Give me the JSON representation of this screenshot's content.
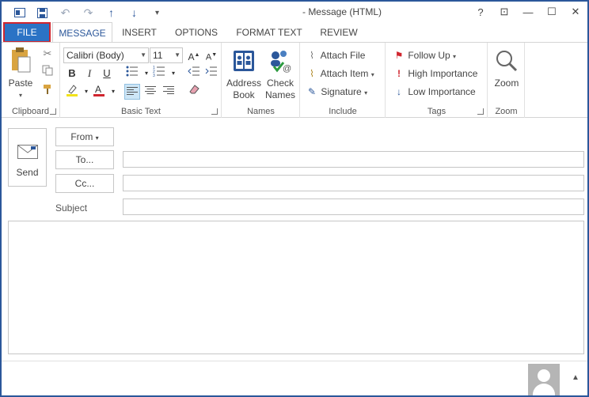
{
  "title": "- Message (HTML)",
  "window_controls": {
    "help": "?",
    "restore_ribbon": "⊡",
    "minimize": "—",
    "maximize": "☐",
    "close": "✕"
  },
  "tabs": [
    {
      "label": "FILE"
    },
    {
      "label": "MESSAGE"
    },
    {
      "label": "INSERT"
    },
    {
      "label": "OPTIONS"
    },
    {
      "label": "FORMAT TEXT"
    },
    {
      "label": "REVIEW"
    }
  ],
  "ribbon": {
    "clipboard": {
      "label": "Clipboard",
      "paste": "Paste"
    },
    "basic_text": {
      "label": "Basic Text",
      "font": "Calibri (Body)",
      "size": "11"
    },
    "names": {
      "label": "Names",
      "address_book_1": "Address",
      "address_book_2": "Book",
      "check_names_1": "Check",
      "check_names_2": "Names"
    },
    "include": {
      "label": "Include",
      "attach_file": "Attach File",
      "attach_item": "Attach Item",
      "signature": "Signature"
    },
    "tags": {
      "label": "Tags",
      "follow_up": "Follow Up",
      "high_importance": "High Importance",
      "low_importance": "Low Importance"
    },
    "zoom": {
      "label": "Zoom",
      "zoom": "Zoom"
    }
  },
  "compose": {
    "send": "Send",
    "from": "From",
    "to": "To...",
    "cc": "Cc...",
    "subject_label": "Subject",
    "to_value": "",
    "cc_value": "",
    "subject_value": "",
    "body_text": ""
  },
  "colors": {
    "accent": "#2b579a",
    "file_tab": "#2b73c5",
    "highlight_border": "#d0262f"
  }
}
